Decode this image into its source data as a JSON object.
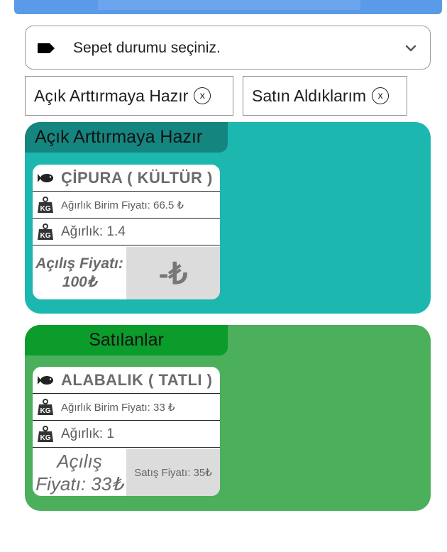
{
  "filter": {
    "placeholder": "Sepet durumu seçiniz."
  },
  "chips": [
    {
      "label": "Açık Arttırmaya Hazır",
      "close": "x"
    },
    {
      "label": "Satın Aldıklarım",
      "close": "x"
    }
  ],
  "sections": [
    {
      "title": "Açık Arttırmaya Hazır",
      "color": "#1cb8b0",
      "item": {
        "name": "ÇİPURA ( KÜLTÜR )",
        "unit_price": "Ağırlık Birim Fiyatı: 66.5 ₺",
        "weight": "Ağırlık: 1.4",
        "opening_price": "Açılış Fiyatı: 100₺",
        "price": "-₺"
      }
    },
    {
      "title": "Satılanlar",
      "color": "#4caf5c",
      "item": {
        "name": "ALABALIK ( TATLI )",
        "unit_price": "Ağırlık Birim Fiyatı: 33 ₺",
        "weight": "Ağırlık: 1",
        "opening_price": "Açılış Fiyatı: 33₺",
        "price": "Satış Fiyatı: 35₺"
      }
    }
  ],
  "icons": [
    "tag-icon",
    "chevron-down-icon",
    "close-circle-icon",
    "fish-icon",
    "weight-kg-icon"
  ]
}
